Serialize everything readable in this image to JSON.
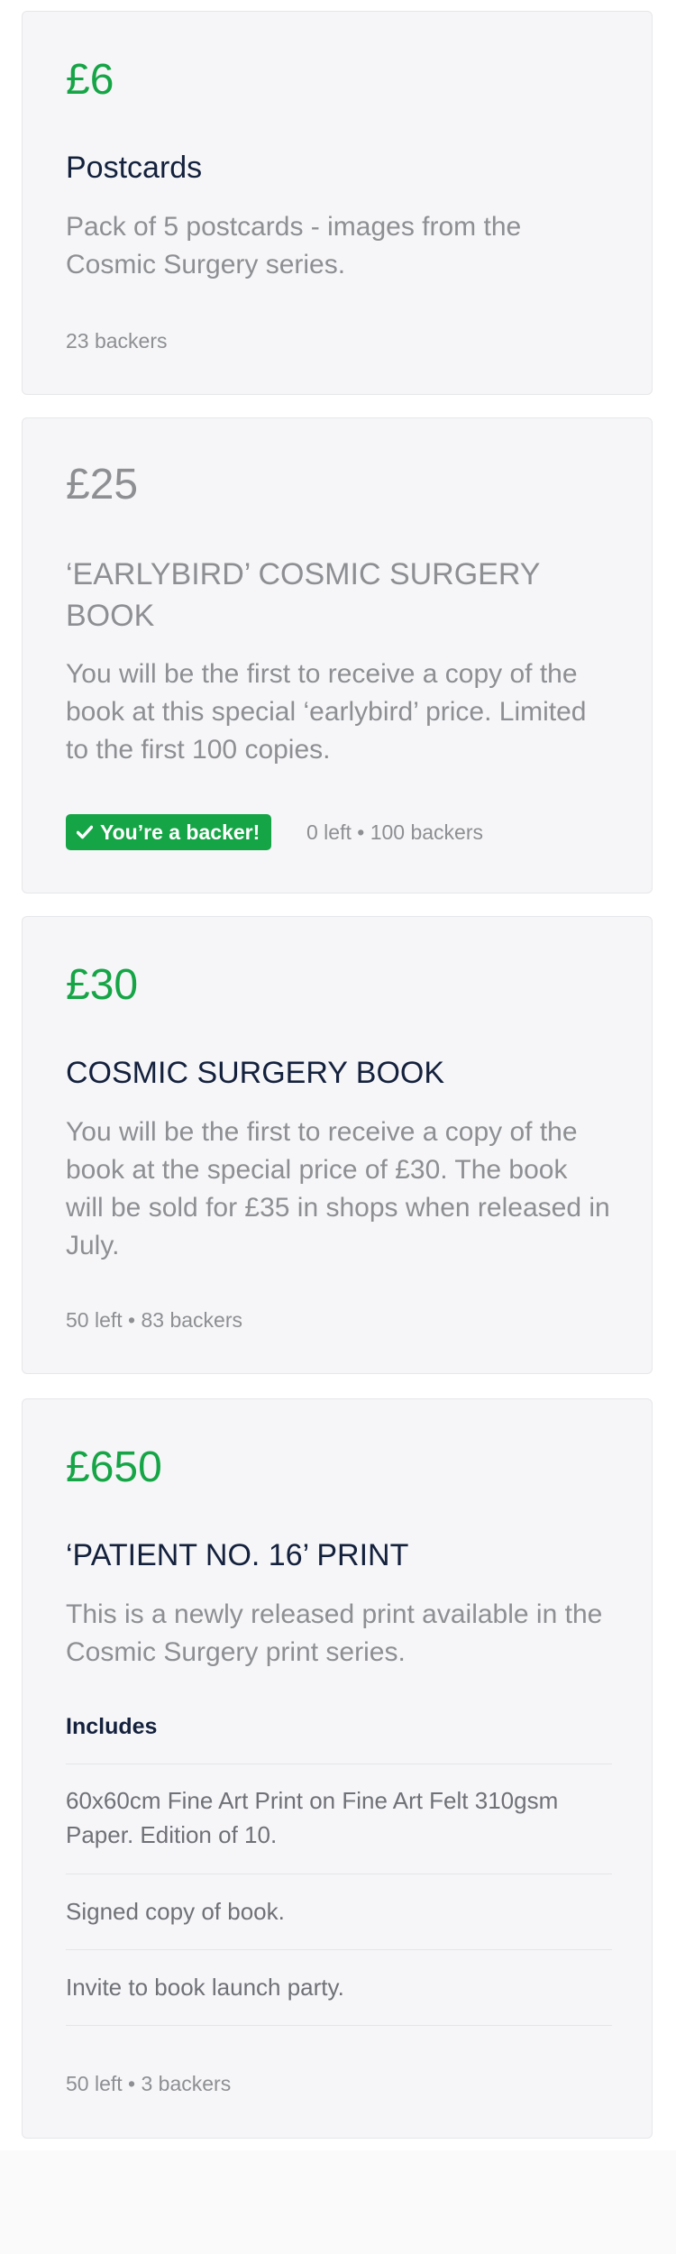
{
  "rewards": [
    {
      "price": "£6",
      "title": "Postcards",
      "description": "Pack of 5 postcards - images from the Cosmic Surgery series.",
      "meta": "23 backers"
    },
    {
      "price": "£25",
      "title": "‘EARLYBIRD’ COSMIC SURGERY BOOK",
      "description": "You will be the first to receive a copy of the book at this special ‘earlybird’ price. Limited to the first 100 copies.",
      "badge": "You’re a backer!",
      "meta": "0 left • 100 backers"
    },
    {
      "price": "£30",
      "title": "COSMIC SURGERY BOOK",
      "description": "You will be the first to receive a copy of the book at the special price of £30. The book will be sold for £35 in shops when released in July.",
      "meta": "50 left • 83 backers"
    },
    {
      "price": "£650",
      "title": "‘PATIENT NO. 16’ PRINT",
      "description": "This is a newly released print available in the Cosmic Surgery print series.",
      "includes_heading": "Includes",
      "includes": [
        "60x60cm Fine Art Print on Fine Art Felt 310gsm Paper. Edition of 10.",
        "Signed copy of book.",
        "Invite to book launch party."
      ],
      "meta": "50 left • 3 backers"
    }
  ],
  "colors": {
    "price_active": "#16a546",
    "price_disabled": "#8d8f93",
    "title": "#14213d",
    "card_background": "#f6f6f8"
  }
}
